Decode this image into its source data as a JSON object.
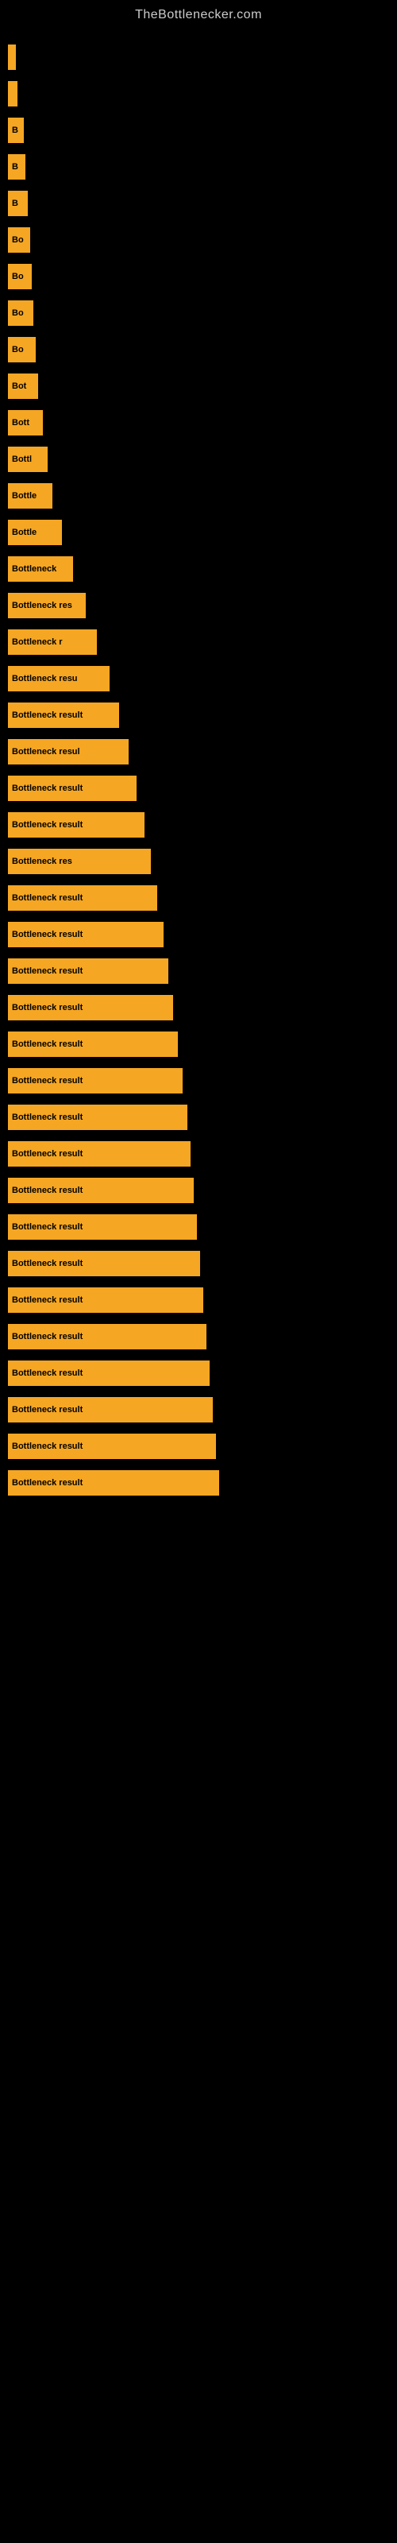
{
  "site": {
    "title": "TheBottlenecker.com"
  },
  "bars": [
    {
      "id": 1,
      "label": "",
      "width_class": "bar-1"
    },
    {
      "id": 2,
      "label": "",
      "width_class": "bar-2"
    },
    {
      "id": 3,
      "label": "B",
      "width_class": "bar-3"
    },
    {
      "id": 4,
      "label": "B",
      "width_class": "bar-4"
    },
    {
      "id": 5,
      "label": "B",
      "width_class": "bar-5"
    },
    {
      "id": 6,
      "label": "Bo",
      "width_class": "bar-6"
    },
    {
      "id": 7,
      "label": "Bo",
      "width_class": "bar-7"
    },
    {
      "id": 8,
      "label": "Bo",
      "width_class": "bar-8"
    },
    {
      "id": 9,
      "label": "Bo",
      "width_class": "bar-9"
    },
    {
      "id": 10,
      "label": "Bot",
      "width_class": "bar-10"
    },
    {
      "id": 11,
      "label": "Bott",
      "width_class": "bar-11"
    },
    {
      "id": 12,
      "label": "Bottl",
      "width_class": "bar-12"
    },
    {
      "id": 13,
      "label": "Bottle",
      "width_class": "bar-13"
    },
    {
      "id": 14,
      "label": "Bottle",
      "width_class": "bar-14"
    },
    {
      "id": 15,
      "label": "Bottleneck",
      "width_class": "bar-15"
    },
    {
      "id": 16,
      "label": "Bottleneck res",
      "width_class": "bar-16"
    },
    {
      "id": 17,
      "label": "Bottleneck r",
      "width_class": "bar-17"
    },
    {
      "id": 18,
      "label": "Bottleneck resu",
      "width_class": "bar-18"
    },
    {
      "id": 19,
      "label": "Bottleneck result",
      "width_class": "bar-19"
    },
    {
      "id": 20,
      "label": "Bottleneck resul",
      "width_class": "bar-20"
    },
    {
      "id": 21,
      "label": "Bottleneck result",
      "width_class": "bar-21"
    },
    {
      "id": 22,
      "label": "Bottleneck result",
      "width_class": "bar-22"
    },
    {
      "id": 23,
      "label": "Bottleneck res",
      "width_class": "bar-23"
    },
    {
      "id": 24,
      "label": "Bottleneck result",
      "width_class": "bar-24"
    },
    {
      "id": 25,
      "label": "Bottleneck result",
      "width_class": "bar-25"
    },
    {
      "id": 26,
      "label": "Bottleneck result",
      "width_class": "bar-26"
    },
    {
      "id": 27,
      "label": "Bottleneck result",
      "width_class": "bar-27"
    },
    {
      "id": 28,
      "label": "Bottleneck result",
      "width_class": "bar-28"
    },
    {
      "id": 29,
      "label": "Bottleneck result",
      "width_class": "bar-29"
    },
    {
      "id": 30,
      "label": "Bottleneck result",
      "width_class": "bar-30"
    },
    {
      "id": 31,
      "label": "Bottleneck result",
      "width_class": "bar-31"
    },
    {
      "id": 32,
      "label": "Bottleneck result",
      "width_class": "bar-32"
    },
    {
      "id": 33,
      "label": "Bottleneck result",
      "width_class": "bar-33"
    },
    {
      "id": 34,
      "label": "Bottleneck result",
      "width_class": "bar-34"
    },
    {
      "id": 35,
      "label": "Bottleneck result",
      "width_class": "bar-35"
    },
    {
      "id": 36,
      "label": "Bottleneck result",
      "width_class": "bar-36"
    },
    {
      "id": 37,
      "label": "Bottleneck result",
      "width_class": "bar-37"
    },
    {
      "id": 38,
      "label": "Bottleneck result",
      "width_class": "bar-38"
    },
    {
      "id": 39,
      "label": "Bottleneck result",
      "width_class": "bar-39"
    },
    {
      "id": 40,
      "label": "Bottleneck result",
      "width_class": "bar-40"
    }
  ]
}
